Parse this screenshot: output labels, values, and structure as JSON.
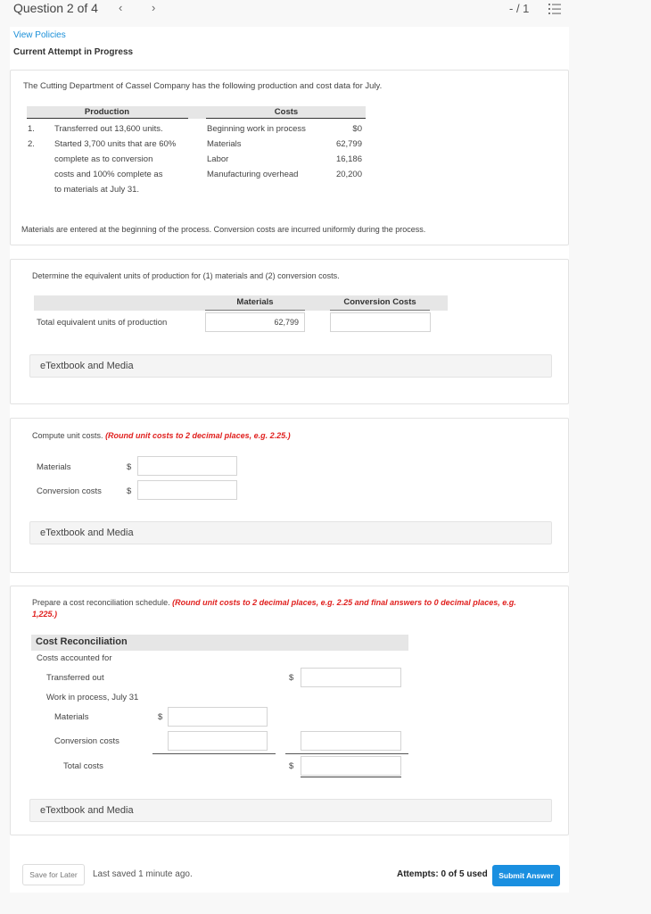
{
  "header": {
    "question_label": "Question 2 of 4",
    "prev_icon": "‹",
    "next_icon": "›",
    "score": "- / 1",
    "list_icon": "question-list-icon"
  },
  "links": {
    "view_policies": "View Policies",
    "attempt_status": "Current Attempt in Progress"
  },
  "problem": {
    "intro": "The Cutting Department of Cassel Company has the following production and cost data for July.",
    "production_header": "Production",
    "costs_header": "Costs",
    "production_items": [
      {
        "num": "1.",
        "lines": [
          "Transferred out 13,600 units."
        ]
      },
      {
        "num": "2.",
        "lines": [
          "Started 3,700 units that are 60%",
          "complete as to conversion",
          "costs and 100% complete as",
          "to materials at July 31."
        ]
      }
    ],
    "costs": [
      {
        "label": "Beginning work in process",
        "value": "$0"
      },
      {
        "label": "Materials",
        "value": "62,799"
      },
      {
        "label": "Labor",
        "value": "16,186"
      },
      {
        "label": "Manufacturing overhead",
        "value": "20,200"
      }
    ],
    "note": "Materials are entered at the beginning of the process. Conversion costs are incurred uniformly during the process."
  },
  "part1": {
    "instruction": "Determine the equivalent units of production for (1) materials and (2) conversion costs.",
    "col_materials": "Materials",
    "col_conversion": "Conversion Costs",
    "row_label": "Total equivalent units of production",
    "materials_value": "62,799",
    "conversion_value": "",
    "etextbook": "eTextbook and Media"
  },
  "part2": {
    "instruction": "Compute unit costs.",
    "hint": "(Round unit costs to 2 decimal places, e.g. 2.25.)",
    "rows": [
      {
        "label": "Materials",
        "currency": "$",
        "value": ""
      },
      {
        "label": "Conversion costs",
        "currency": "$",
        "value": ""
      }
    ],
    "etextbook": "eTextbook and Media"
  },
  "part3": {
    "instruction": "Prepare a cost reconciliation schedule.",
    "hint_line1": "(Round unit costs to 2 decimal places, e.g. 2.25 and final answers to 0 decimal places, e.g.",
    "hint_line2": "1,225.)",
    "table_title": "Cost Reconciliation",
    "costs_accounted_for": "Costs accounted for",
    "transferred_out": "Transferred out",
    "wip_label": "Work in process, July 31",
    "materials": "Materials",
    "conversion_costs": "Conversion costs",
    "total_costs": "Total costs",
    "currency": "$",
    "values": {
      "transferred_out": "",
      "wip_materials": "",
      "wip_conversion": "",
      "wip_total": "",
      "total_costs": ""
    },
    "etextbook": "eTextbook and Media"
  },
  "footer": {
    "save_label": "Save for Later",
    "last_saved": "Last saved 1 minute ago.",
    "attempts": "Attempts: 0 of 5 used",
    "submit_label": "Submit Answer"
  },
  "colors": {
    "accent": "#1a8fe0",
    "hint_red": "#e0201e",
    "link": "#1a8fd8"
  }
}
